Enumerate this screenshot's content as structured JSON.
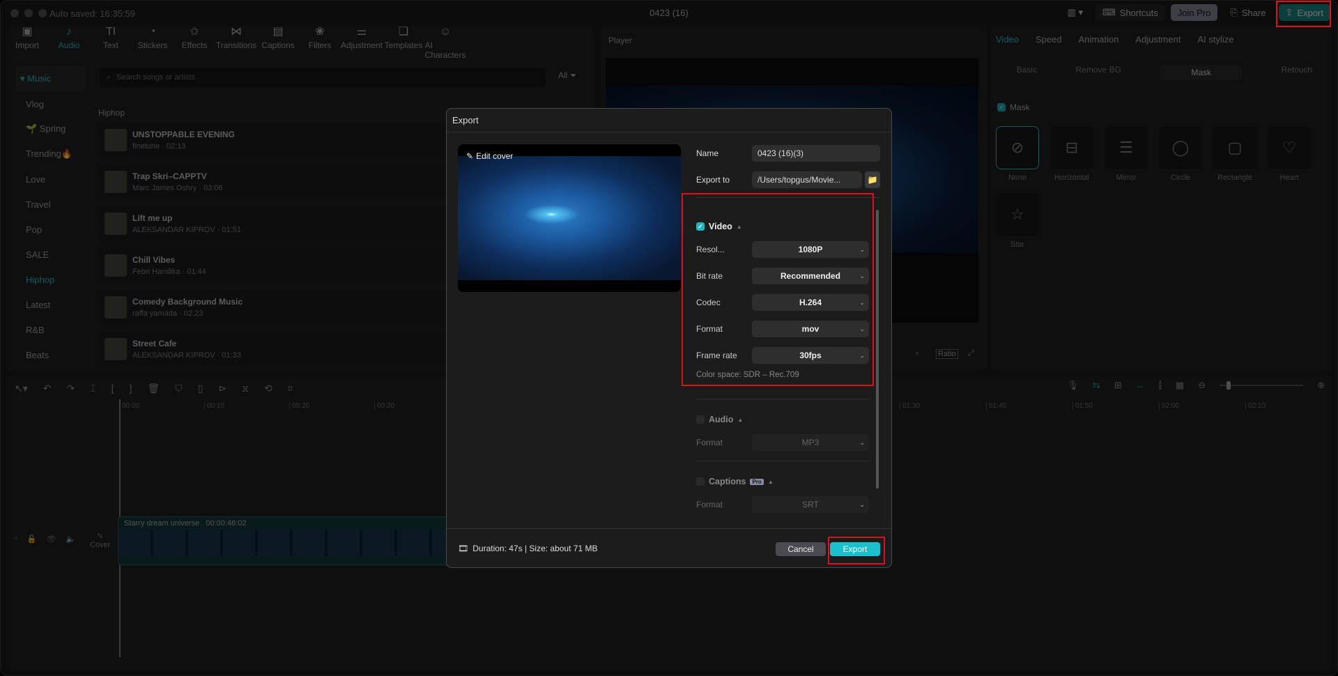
{
  "window": {
    "autosaved": "Auto saved: 16:35:59",
    "title": "0423 (16)"
  },
  "topbar": {
    "shortcuts": "Shortcuts",
    "join_pro": "Join Pro",
    "share": "Share",
    "export": "Export"
  },
  "toolbar": [
    {
      "label": "Import",
      "icon": "▣"
    },
    {
      "label": "Audio",
      "icon": "♪",
      "active": true
    },
    {
      "label": "Text",
      "icon": "TI"
    },
    {
      "label": "Stickers",
      "icon": "◔"
    },
    {
      "label": "Effects",
      "icon": "✩"
    },
    {
      "label": "Transitions",
      "icon": "⋈"
    },
    {
      "label": "Captions",
      "icon": "▤"
    },
    {
      "label": "Filters",
      "icon": "❀"
    },
    {
      "label": "Adjustment",
      "icon": "⚌"
    },
    {
      "label": "Templates",
      "icon": "❏"
    },
    {
      "label": "AI Characters",
      "icon": "☺"
    }
  ],
  "sidebar": {
    "header": "▾ Music",
    "items": [
      "Vlog",
      "🌱 Spring",
      "Trending🔥",
      "Love",
      "Travel",
      "Pop",
      "SALE",
      "Hiphop",
      "Latest",
      "R&B",
      "Beats"
    ],
    "selected": "Hiphop"
  },
  "search": {
    "placeholder": "Search songs or artists"
  },
  "filter": {
    "label": "All"
  },
  "section_title": "Hiphop",
  "songs": [
    {
      "title": "UNSTOPPABLE EVENING",
      "sub": "finetune · 02:13"
    },
    {
      "title": "Trap Skri–CAPPTV",
      "sub": "Marc James Oshry · 03:06"
    },
    {
      "title": "Lift me up",
      "sub": "ALEKSANDAR KIPROV · 01:51"
    },
    {
      "title": "Chill Vibes",
      "sub": "Febri Handika · 01:44"
    },
    {
      "title": "Comedy Background Music",
      "sub": "raffa yamada · 02:23"
    },
    {
      "title": "Street Cafe",
      "sub": "ALEKSANDAR KIPROV · 01:33"
    }
  ],
  "player": {
    "title": "Player",
    "ratio": "Ratio"
  },
  "right_panel": {
    "tabs": [
      "Video",
      "Speed",
      "Animation",
      "Adjustment",
      "AI stylize"
    ],
    "sub_tabs": [
      "Basic",
      "Remove BG",
      "Mask",
      "Retouch"
    ],
    "mask_header": "Mask",
    "masks": [
      {
        "label": "None",
        "icon": "⊘"
      },
      {
        "label": "Horizontal",
        "icon": "⊟"
      },
      {
        "label": "Mirror",
        "icon": "☰"
      },
      {
        "label": "Circle",
        "icon": "◯"
      },
      {
        "label": "Rectangle",
        "icon": "▢"
      },
      {
        "label": "Heart",
        "icon": "♡"
      },
      {
        "label": "Star",
        "icon": "☆"
      }
    ]
  },
  "timeline": {
    "ruler_left": [
      "00:00",
      "00:10",
      "00:20",
      "00:30"
    ],
    "ruler_right": [
      "01:30",
      "01:40",
      "01:50",
      "02:00",
      "02:10"
    ],
    "clip_name": "Starry dream universe",
    "clip_duration": "00:00:46:02",
    "cover_label": "Cover"
  },
  "dialog": {
    "title": "Export",
    "edit_cover": "Edit cover",
    "name_label": "Name",
    "name_value": "0423 (16)(3)",
    "export_to_label": "Export to",
    "export_to_value": "/Users/topgus/Movie...",
    "video": {
      "label": "Video",
      "enabled": true,
      "rows": [
        {
          "label": "Resol...",
          "value": "1080P"
        },
        {
          "label": "Bit rate",
          "value": "Recommended"
        },
        {
          "label": "Codec",
          "value": "H.264"
        },
        {
          "label": "Format",
          "value": "mov"
        },
        {
          "label": "Frame rate",
          "value": "30fps"
        }
      ],
      "color_space": "Color space: SDR – Rec.709"
    },
    "audio": {
      "label": "Audio",
      "enabled": false,
      "format_label": "Format",
      "format_value": "MP3"
    },
    "captions": {
      "label": "Captions",
      "badge": "Pro",
      "enabled": false,
      "format_label": "Format",
      "format_value": "SRT"
    },
    "footer_info": "Duration: 47s | Size: about 71 MB",
    "cancel": "Cancel",
    "export": "Export"
  }
}
